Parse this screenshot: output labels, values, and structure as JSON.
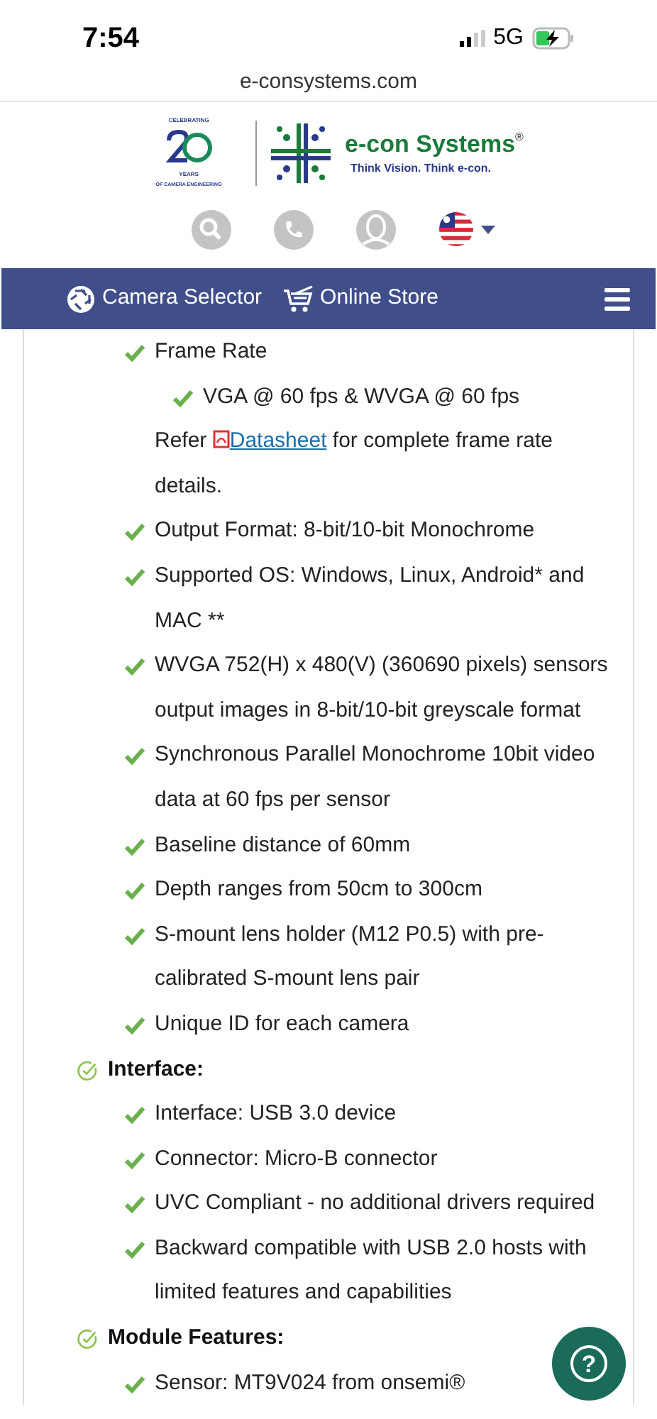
{
  "status_bar": {
    "time": "7:54",
    "network": "5G"
  },
  "address_bar": {
    "url": "e-consystems.com"
  },
  "logo": {
    "anniversary_top": "CELEBRATING",
    "anniversary_bottom": "YEARS",
    "anniversary_caption": "OF CAMERA ENGINEERING",
    "brand": "e-con Systems",
    "registered": "®",
    "tagline": "Think Vision. Think e-con."
  },
  "nav": {
    "items": [
      {
        "label": "Camera Selector",
        "kind": "camera"
      },
      {
        "label": "Online Store",
        "kind": "cart"
      }
    ]
  },
  "content": [
    {
      "kind": "bullet",
      "text": "Frame Rate",
      "children": [
        {
          "kind": "bullet",
          "text": "VGA @ 60 fps & WVGA @ 60 fps"
        }
      ]
    },
    {
      "kind": "note",
      "before": "Refer ",
      "link": "Datasheet",
      "after": " for complete frame rate details."
    },
    {
      "kind": "bullet",
      "text": "Output Format: 8-bit/10-bit Monochrome"
    },
    {
      "kind": "bullet",
      "text": "Supported OS: Windows, Linux, Android* and MAC **"
    },
    {
      "kind": "bullet",
      "text": "WVGA 752(H) x 480(V) (360690 pixels) sensors output images in 8-bit/10-bit greyscale format"
    },
    {
      "kind": "bullet",
      "text": "Synchronous Parallel Monochrome 10bit video data at 60 fps per sensor"
    },
    {
      "kind": "bullet",
      "text": "Baseline distance of 60mm"
    },
    {
      "kind": "bullet",
      "text": "Depth ranges from 50cm to 300cm"
    },
    {
      "kind": "bullet",
      "text": "S-mount lens holder (M12 P0.5) with pre-calibrated S-mount lens pair"
    },
    {
      "kind": "bullet",
      "text": "Unique ID for each camera"
    },
    {
      "kind": "heading",
      "text": "Interface:",
      "children": [
        {
          "kind": "bullet",
          "text": "Interface: USB 3.0 device"
        },
        {
          "kind": "bullet",
          "text": "Connector: Micro-B connector"
        },
        {
          "kind": "bullet",
          "text": "UVC Compliant - no additional drivers required"
        },
        {
          "kind": "bullet",
          "text": "Backward compatible with USB 2.0 hosts with limited features and capabilities"
        }
      ]
    },
    {
      "kind": "heading",
      "text": "Module Features:",
      "children": [
        {
          "kind": "bullet",
          "text": "Sensor: MT9V024 from onsemi®"
        }
      ]
    }
  ],
  "help_button": {
    "label": "?"
  }
}
